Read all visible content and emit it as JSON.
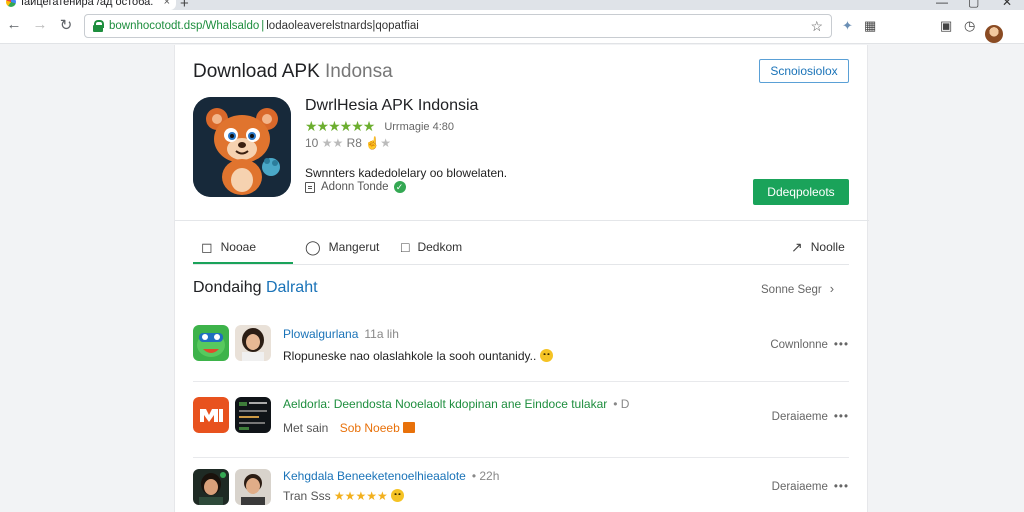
{
  "browser": {
    "tab_title": "Iаицегатенира /ад остоба.",
    "tab_close": "×",
    "new_tab": "+",
    "url_domain": "bownhocotodt.dsp/Whalsaldo",
    "url_path": "lodaoleaverelstnards|qopatfiai",
    "window_controls": [
      "—",
      "▢",
      "✕"
    ]
  },
  "header": {
    "title": "Download APK",
    "title_sub": "Indonsa",
    "outline_button": "Scnoiosiolox"
  },
  "app": {
    "name": "DwrlHesia APK Indonsia",
    "rating_stars": "★★★★★★",
    "rating_count": "Urrmagie 4:80",
    "meta": "10",
    "meta_stars": "★★",
    "meta_rating": "R8",
    "description": "Swnnters  kadedolelary oo blowelaten.",
    "author": "Adonn Tonde",
    "download_button": "Ddeqpoleots"
  },
  "tabs": [
    {
      "icon": "bookmark-icon",
      "label": "Nooae"
    },
    {
      "icon": "chat-icon",
      "label": "Mangerut"
    },
    {
      "icon": "comment-icon",
      "label": "Dedkom"
    },
    {
      "icon": "share-icon",
      "label": "Noolle"
    }
  ],
  "section": {
    "title": "Dondaihg",
    "title_accent": "Dalraht",
    "see_more": "Sonne Segr"
  },
  "rows": [
    {
      "title": "Plowalgurlana",
      "time": "11a lih",
      "line2": "Rlopuneske nao olaslahkole la sooh ountanidy..",
      "right": "Cownlonne",
      "dots": "•••"
    },
    {
      "title": "Aeldorla: Deendosta Nooelaolt kdopinan ane",
      "title_green": "Eindoce tulakar",
      "time": "• D",
      "line2_a": "Met sain",
      "line2_b": "Sob Noeeb",
      "right": "Deraiaeme",
      "dots": "•••"
    },
    {
      "title": "Kehgdala Beneeketenoelhieaalote",
      "time": "• 22h",
      "line2": "Tran Sss",
      "line2_stars": "★★★★★",
      "right": "Deraiaeme",
      "dots": "•••"
    }
  ],
  "colors": {
    "accent_green": "#1aa35a",
    "link_blue": "#1a73b8",
    "star_green": "#6cae2f"
  }
}
